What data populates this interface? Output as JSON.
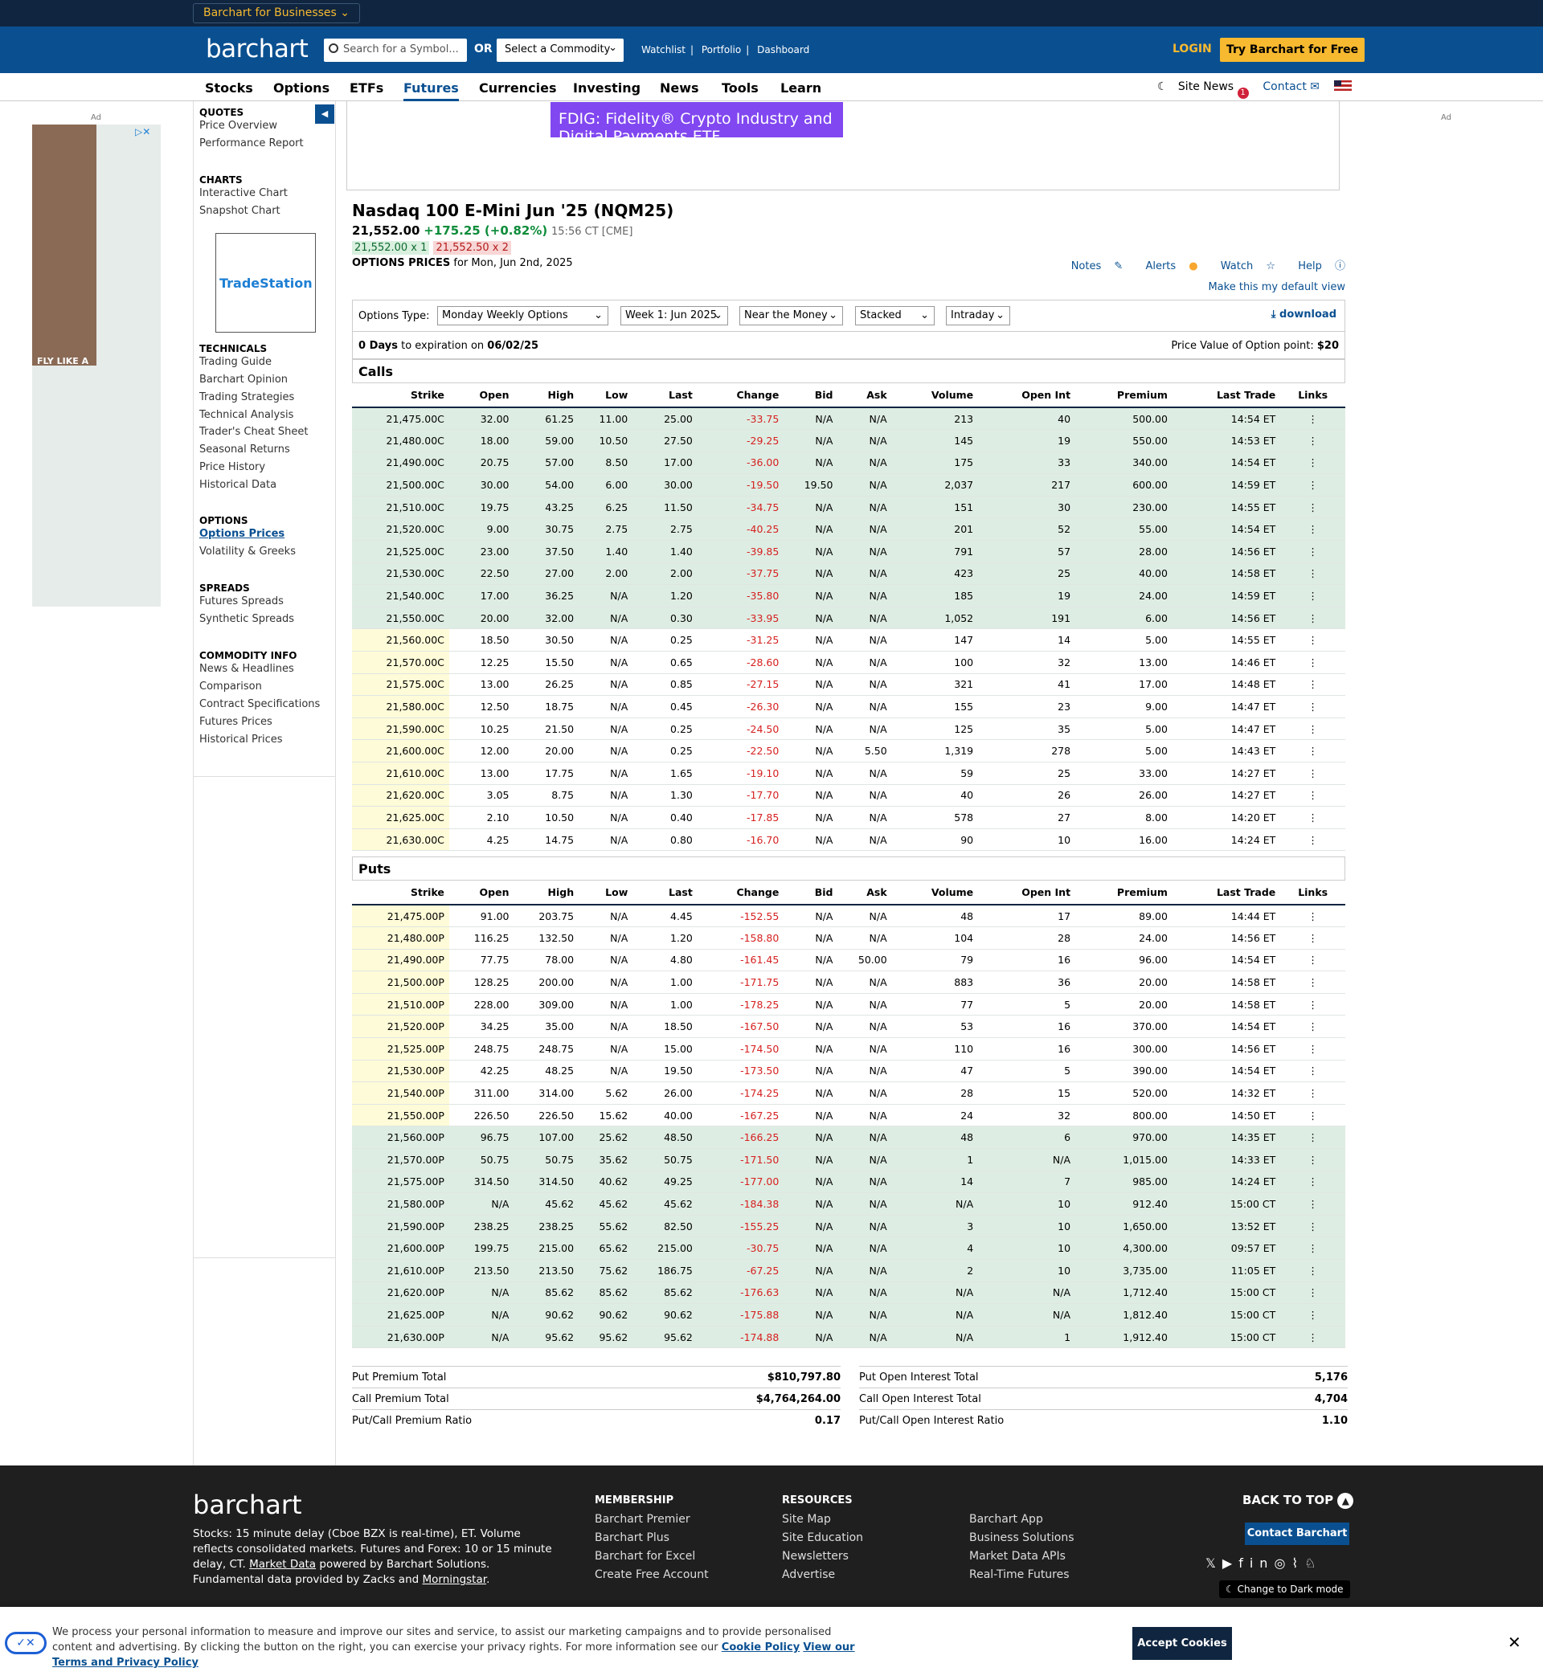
{
  "topbar": {
    "business_label": "Barchart for Businesses"
  },
  "header": {
    "logo": "barchart",
    "search_placeholder": "Search for a Symbol...",
    "or": "OR",
    "commodity": "Select a Commodity",
    "links": [
      "Watchlist",
      "Portfolio",
      "Dashboard"
    ],
    "login": "LOGIN",
    "try": "Try Barchart for Free"
  },
  "nav": {
    "items": [
      "Stocks",
      "Options",
      "ETFs",
      "Futures",
      "Currencies",
      "Investing",
      "News",
      "Tools",
      "Learn"
    ],
    "active": "Futures",
    "site_news": "Site News",
    "badge": "1",
    "contact": "Contact"
  },
  "ads": {
    "left_label": "Ad",
    "right_label": "Ad",
    "left_text": "FLY LIKE A",
    "top_ad_text": "FDIG: Fidelity® Crypto Industry and Digital Payments ETF",
    "tradestation": "TradeStation"
  },
  "sidebar": {
    "sections": [
      {
        "title": "QUOTES",
        "items": [
          "Price Overview",
          "Performance Report"
        ]
      },
      {
        "title": "CHARTS",
        "items": [
          "Interactive Chart",
          "Snapshot Chart"
        ]
      },
      {
        "title": "TECHNICALS",
        "items": [
          "Trading Guide",
          "Barchart Opinion",
          "Trading Strategies",
          "Technical Analysis",
          "Trader's Cheat Sheet",
          "Seasonal Returns",
          "Price History",
          "Historical Data"
        ]
      },
      {
        "title": "OPTIONS",
        "items": [
          "Options Prices",
          "Volatility & Greeks"
        ]
      },
      {
        "title": "SPREADS",
        "items": [
          "Futures Spreads",
          "Synthetic Spreads"
        ]
      },
      {
        "title": "COMMODITY INFO",
        "items": [
          "News & Headlines",
          "Comparison",
          "Contract Specifications",
          "Futures Prices",
          "Historical Prices"
        ]
      }
    ]
  },
  "quote": {
    "title": "Nasdaq 100 E-Mini Jun '25 (NQM25)",
    "price": "21,552.00",
    "change": "+175.25 (+0.82%)",
    "time": "15:56 CT [CME]",
    "bid": "21,552.00 x 1",
    "ask": "21,552.50 x 2",
    "options_prices_label": "OPTIONS PRICES",
    "options_date": "for Mon, Jun 2nd, 2025"
  },
  "tools": {
    "notes": "Notes",
    "alerts": "Alerts",
    "watch": "Watch",
    "help": "Help",
    "default_view": "Make this my default view"
  },
  "controls": {
    "type_label": "Options Type:",
    "type": "Monday Weekly Options",
    "expiry": "Week 1: Jun 2025",
    "range": "Near the Money",
    "view": "Stacked",
    "period": "Intraday",
    "download": "download"
  },
  "expiration": {
    "days": "0 Days",
    "text": "to expiration on",
    "date": "06/02/25",
    "point_label": "Price Value of Option point:",
    "point_value": "$20"
  },
  "columns": [
    "Strike",
    "Open",
    "High",
    "Low",
    "Last",
    "Change",
    "Bid",
    "Ask",
    "Volume",
    "Open Int",
    "Premium",
    "Last Trade",
    "Links"
  ],
  "calls_title": "Calls",
  "puts_title": "Puts",
  "calls": [
    [
      "21,475.00C",
      "32.00",
      "61.25",
      "11.00",
      "25.00",
      "-33.75",
      "N/A",
      "N/A",
      "213",
      "40",
      "500.00",
      "14:54 ET"
    ],
    [
      "21,480.00C",
      "18.00",
      "59.00",
      "10.50",
      "27.50",
      "-29.25",
      "N/A",
      "N/A",
      "145",
      "19",
      "550.00",
      "14:53 ET"
    ],
    [
      "21,490.00C",
      "20.75",
      "57.00",
      "8.50",
      "17.00",
      "-36.00",
      "N/A",
      "N/A",
      "175",
      "33",
      "340.00",
      "14:54 ET"
    ],
    [
      "21,500.00C",
      "30.00",
      "54.00",
      "6.00",
      "30.00",
      "-19.50",
      "19.50",
      "N/A",
      "2,037",
      "217",
      "600.00",
      "14:59 ET"
    ],
    [
      "21,510.00C",
      "19.75",
      "43.25",
      "6.25",
      "11.50",
      "-34.75",
      "N/A",
      "N/A",
      "151",
      "30",
      "230.00",
      "14:55 ET"
    ],
    [
      "21,520.00C",
      "9.00",
      "30.75",
      "2.75",
      "2.75",
      "-40.25",
      "N/A",
      "N/A",
      "201",
      "52",
      "55.00",
      "14:54 ET"
    ],
    [
      "21,525.00C",
      "23.00",
      "37.50",
      "1.40",
      "1.40",
      "-39.85",
      "N/A",
      "N/A",
      "791",
      "57",
      "28.00",
      "14:56 ET"
    ],
    [
      "21,530.00C",
      "22.50",
      "27.00",
      "2.00",
      "2.00",
      "-37.75",
      "N/A",
      "N/A",
      "423",
      "25",
      "40.00",
      "14:58 ET"
    ],
    [
      "21,540.00C",
      "17.00",
      "36.25",
      "N/A",
      "1.20",
      "-35.80",
      "N/A",
      "N/A",
      "185",
      "19",
      "24.00",
      "14:59 ET"
    ],
    [
      "21,550.00C",
      "20.00",
      "32.00",
      "N/A",
      "0.30",
      "-33.95",
      "N/A",
      "N/A",
      "1,052",
      "191",
      "6.00",
      "14:56 ET"
    ],
    [
      "21,560.00C",
      "18.50",
      "30.50",
      "N/A",
      "0.25",
      "-31.25",
      "N/A",
      "N/A",
      "147",
      "14",
      "5.00",
      "14:55 ET"
    ],
    [
      "21,570.00C",
      "12.25",
      "15.50",
      "N/A",
      "0.65",
      "-28.60",
      "N/A",
      "N/A",
      "100",
      "32",
      "13.00",
      "14:46 ET"
    ],
    [
      "21,575.00C",
      "13.00",
      "26.25",
      "N/A",
      "0.85",
      "-27.15",
      "N/A",
      "N/A",
      "321",
      "41",
      "17.00",
      "14:48 ET"
    ],
    [
      "21,580.00C",
      "12.50",
      "18.75",
      "N/A",
      "0.45",
      "-26.30",
      "N/A",
      "N/A",
      "155",
      "23",
      "9.00",
      "14:47 ET"
    ],
    [
      "21,590.00C",
      "10.25",
      "21.50",
      "N/A",
      "0.25",
      "-24.50",
      "N/A",
      "N/A",
      "125",
      "35",
      "5.00",
      "14:47 ET"
    ],
    [
      "21,600.00C",
      "12.00",
      "20.00",
      "N/A",
      "0.25",
      "-22.50",
      "N/A",
      "5.50",
      "1,319",
      "278",
      "5.00",
      "14:43 ET"
    ],
    [
      "21,610.00C",
      "13.00",
      "17.75",
      "N/A",
      "1.65",
      "-19.10",
      "N/A",
      "N/A",
      "59",
      "25",
      "33.00",
      "14:27 ET"
    ],
    [
      "21,620.00C",
      "3.05",
      "8.75",
      "N/A",
      "1.30",
      "-17.70",
      "N/A",
      "N/A",
      "40",
      "26",
      "26.00",
      "14:27 ET"
    ],
    [
      "21,625.00C",
      "2.10",
      "10.50",
      "N/A",
      "0.40",
      "-17.85",
      "N/A",
      "N/A",
      "578",
      "27",
      "8.00",
      "14:20 ET"
    ],
    [
      "21,630.00C",
      "4.25",
      "14.75",
      "N/A",
      "0.80",
      "-16.70",
      "N/A",
      "N/A",
      "90",
      "10",
      "16.00",
      "14:24 ET"
    ]
  ],
  "calls_itm_count": 10,
  "puts": [
    [
      "21,475.00P",
      "91.00",
      "203.75",
      "N/A",
      "4.45",
      "-152.55",
      "N/A",
      "N/A",
      "48",
      "17",
      "89.00",
      "14:44 ET"
    ],
    [
      "21,480.00P",
      "116.25",
      "132.50",
      "N/A",
      "1.20",
      "-158.80",
      "N/A",
      "N/A",
      "104",
      "28",
      "24.00",
      "14:56 ET"
    ],
    [
      "21,490.00P",
      "77.75",
      "78.00",
      "N/A",
      "4.80",
      "-161.45",
      "N/A",
      "50.00",
      "79",
      "16",
      "96.00",
      "14:54 ET"
    ],
    [
      "21,500.00P",
      "128.25",
      "200.00",
      "N/A",
      "1.00",
      "-171.75",
      "N/A",
      "N/A",
      "883",
      "36",
      "20.00",
      "14:58 ET"
    ],
    [
      "21,510.00P",
      "228.00",
      "309.00",
      "N/A",
      "1.00",
      "-178.25",
      "N/A",
      "N/A",
      "77",
      "5",
      "20.00",
      "14:58 ET"
    ],
    [
      "21,520.00P",
      "34.25",
      "35.00",
      "N/A",
      "18.50",
      "-167.50",
      "N/A",
      "N/A",
      "53",
      "16",
      "370.00",
      "14:54 ET"
    ],
    [
      "21,525.00P",
      "248.75",
      "248.75",
      "N/A",
      "15.00",
      "-174.50",
      "N/A",
      "N/A",
      "110",
      "16",
      "300.00",
      "14:56 ET"
    ],
    [
      "21,530.00P",
      "42.25",
      "48.25",
      "N/A",
      "19.50",
      "-173.50",
      "N/A",
      "N/A",
      "47",
      "5",
      "390.00",
      "14:54 ET"
    ],
    [
      "21,540.00P",
      "311.00",
      "314.00",
      "5.62",
      "26.00",
      "-174.25",
      "N/A",
      "N/A",
      "28",
      "15",
      "520.00",
      "14:32 ET"
    ],
    [
      "21,550.00P",
      "226.50",
      "226.50",
      "15.62",
      "40.00",
      "-167.25",
      "N/A",
      "N/A",
      "24",
      "32",
      "800.00",
      "14:50 ET"
    ],
    [
      "21,560.00P",
      "96.75",
      "107.00",
      "25.62",
      "48.50",
      "-166.25",
      "N/A",
      "N/A",
      "48",
      "6",
      "970.00",
      "14:35 ET"
    ],
    [
      "21,570.00P",
      "50.75",
      "50.75",
      "35.62",
      "50.75",
      "-171.50",
      "N/A",
      "N/A",
      "1",
      "N/A",
      "1,015.00",
      "14:33 ET"
    ],
    [
      "21,575.00P",
      "314.50",
      "314.50",
      "40.62",
      "49.25",
      "-177.00",
      "N/A",
      "N/A",
      "14",
      "7",
      "985.00",
      "14:24 ET"
    ],
    [
      "21,580.00P",
      "N/A",
      "45.62",
      "45.62",
      "45.62",
      "-184.38",
      "N/A",
      "N/A",
      "N/A",
      "10",
      "912.40",
      "15:00 CT"
    ],
    [
      "21,590.00P",
      "238.25",
      "238.25",
      "55.62",
      "82.50",
      "-155.25",
      "N/A",
      "N/A",
      "3",
      "10",
      "1,650.00",
      "13:52 ET"
    ],
    [
      "21,600.00P",
      "199.75",
      "215.00",
      "65.62",
      "215.00",
      "-30.75",
      "N/A",
      "N/A",
      "4",
      "10",
      "4,300.00",
      "09:57 ET"
    ],
    [
      "21,610.00P",
      "213.50",
      "213.50",
      "75.62",
      "186.75",
      "-67.25",
      "N/A",
      "N/A",
      "2",
      "10",
      "3,735.00",
      "11:05 ET"
    ],
    [
      "21,620.00P",
      "N/A",
      "85.62",
      "85.62",
      "85.62",
      "-176.63",
      "N/A",
      "N/A",
      "N/A",
      "N/A",
      "1,712.40",
      "15:00 CT"
    ],
    [
      "21,625.00P",
      "N/A",
      "90.62",
      "90.62",
      "90.62",
      "-175.88",
      "N/A",
      "N/A",
      "N/A",
      "N/A",
      "1,812.40",
      "15:00 CT"
    ],
    [
      "21,630.00P",
      "N/A",
      "95.62",
      "95.62",
      "95.62",
      "-174.88",
      "N/A",
      "N/A",
      "N/A",
      "1",
      "1,912.40",
      "15:00 CT"
    ]
  ],
  "puts_otm_count": 10,
  "totals": {
    "put_premium_label": "Put Premium Total",
    "put_premium": "$810,797.80",
    "call_premium_label": "Call Premium Total",
    "call_premium": "$4,764,264.00",
    "pc_premium_label": "Put/Call Premium Ratio",
    "pc_premium": "0.17",
    "put_oi_label": "Put Open Interest Total",
    "put_oi": "5,176",
    "call_oi_label": "Call Open Interest Total",
    "call_oi": "4,704",
    "pc_oi_label": "Put/Call Open Interest Ratio",
    "pc_oi": "1.10"
  },
  "footer": {
    "logo": "barchart",
    "desc_1": "Stocks: 15 minute delay (Cboe BZX is real-time), ET. Volume reflects consolidated markets. Futures and Forex: 10 or 15 minute delay, CT.",
    "market_data": "Market Data",
    "desc_2": "powered by Barchart Solutions. Fundamental data provided by Zacks and",
    "morningstar": "Morningstar",
    "membership_title": "MEMBERSHIP",
    "membership": [
      "Barchart Premier",
      "Barchart Plus",
      "Barchart for Excel",
      "Create Free Account"
    ],
    "resources_title": "RESOURCES",
    "resources": [
      "Site Map",
      "Site Education",
      "Newsletters",
      "Advertise"
    ],
    "more": [
      "Barchart App",
      "Business Solutions",
      "Market Data APIs",
      "Real-Time Futures"
    ],
    "back_to_top": "BACK TO TOP",
    "contact_button": "Contact Barchart",
    "dark_mode": "Change to Dark mode"
  },
  "cookie": {
    "text": "We process your personal information to measure and improve our sites and service, to assist our marketing campaigns and to provide personalised content and advertising. By clicking the button on the right, you can exercise your privacy rights. For more information see our",
    "policy": "Cookie Policy",
    "terms": "View our Terms and Privacy Policy",
    "accept": "Accept Cookies"
  }
}
